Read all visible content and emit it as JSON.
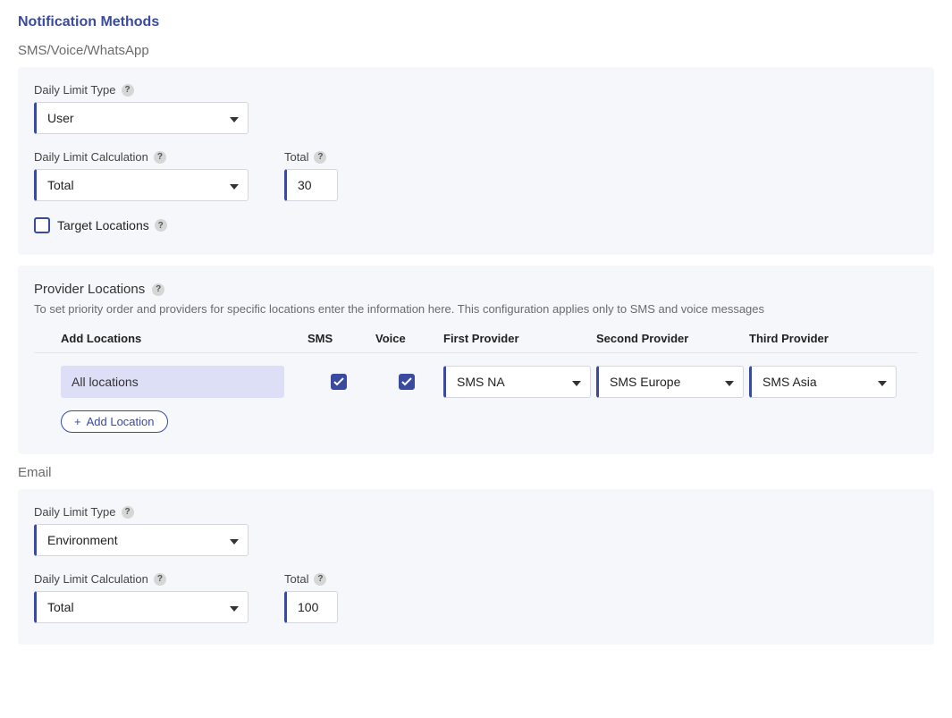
{
  "title": "Notification Methods",
  "smsSection": {
    "label": "SMS/Voice/WhatsApp",
    "dailyLimitType": {
      "label": "Daily Limit Type",
      "value": "User"
    },
    "dailyLimitCalc": {
      "label": "Daily Limit Calculation",
      "value": "Total"
    },
    "total": {
      "label": "Total",
      "value": "30"
    },
    "targetLocations": {
      "label": "Target Locations",
      "checked": false
    }
  },
  "providerLocations": {
    "title": "Provider Locations",
    "desc": "To set priority order and providers for specific locations enter the information here. This configuration applies only to SMS and voice messages",
    "columns": {
      "addLocations": "Add Locations",
      "sms": "SMS",
      "voice": "Voice",
      "first": "First Provider",
      "second": "Second Provider",
      "third": "Third Provider"
    },
    "row": {
      "location": "All locations",
      "smsChecked": true,
      "voiceChecked": true,
      "first": "SMS NA",
      "second": "SMS Europe",
      "third": "SMS Asia"
    },
    "addLocationBtn": "Add Location"
  },
  "emailSection": {
    "label": "Email",
    "dailyLimitType": {
      "label": "Daily Limit Type",
      "value": "Environment"
    },
    "dailyLimitCalc": {
      "label": "Daily Limit Calculation",
      "value": "Total"
    },
    "total": {
      "label": "Total",
      "value": "100"
    }
  }
}
